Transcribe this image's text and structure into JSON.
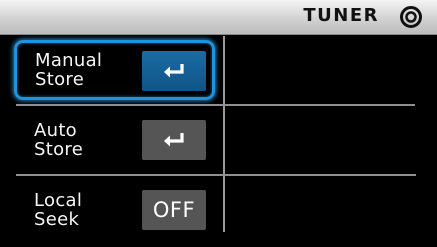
{
  "header": {
    "title": "TUNER",
    "icon": "tuner-ring-icon"
  },
  "menu": {
    "items": [
      {
        "label_line1": "Manual",
        "label_line2": "Store",
        "control": "enter-icon",
        "selected": true
      },
      {
        "label_line1": "Auto",
        "label_line2": "Store",
        "control": "enter-icon",
        "selected": false
      },
      {
        "label_line1": "Local",
        "label_line2": "Seek",
        "control_value": "OFF",
        "selected": false
      }
    ]
  },
  "colors": {
    "header_bg": "#d6d6d6",
    "selection_border": "#1f93dd",
    "button_active": "#125d94",
    "button_inactive": "#555555",
    "divider": "#9a9a9a"
  }
}
